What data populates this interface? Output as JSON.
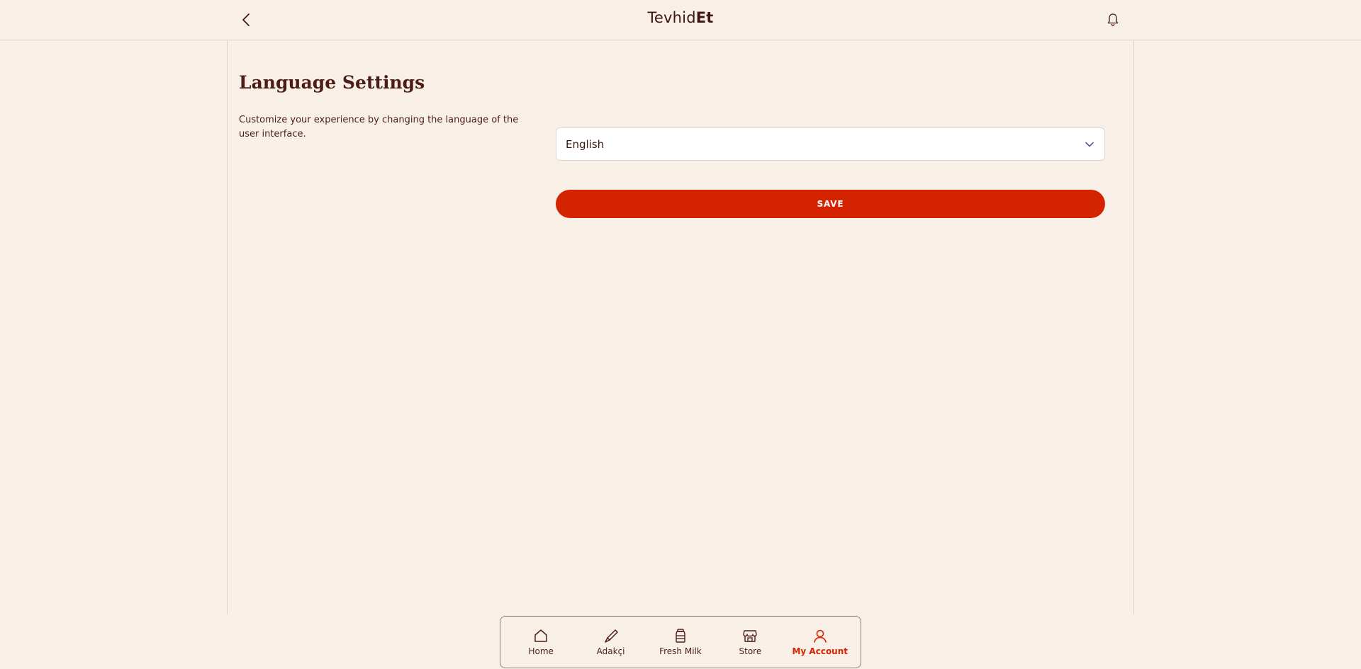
{
  "header": {
    "brand_regular": "Tevhid",
    "brand_bold": "Et",
    "back_icon": "chevron-left-icon",
    "notifications_icon": "bell-icon"
  },
  "main": {
    "title": "Language Settings",
    "description": "Customize your experience by changing the language of the user interface.",
    "language_select": {
      "value": "English",
      "icon": "chevron-down-icon"
    },
    "save_label": "SAVE"
  },
  "bottom_nav": {
    "items": [
      {
        "label": "Home",
        "icon": "home-icon",
        "active": false
      },
      {
        "label": "Adakçi",
        "icon": "knife-icon",
        "active": false
      },
      {
        "label": "Fresh Milk",
        "icon": "milk-jar-icon",
        "active": false
      },
      {
        "label": "Store",
        "icon": "store-icon",
        "active": false
      },
      {
        "label": "My Account",
        "icon": "user-icon",
        "active": true
      }
    ]
  },
  "colors": {
    "background": "#f8f0e7",
    "accent": "#d42300",
    "text": "#4b1d14"
  }
}
